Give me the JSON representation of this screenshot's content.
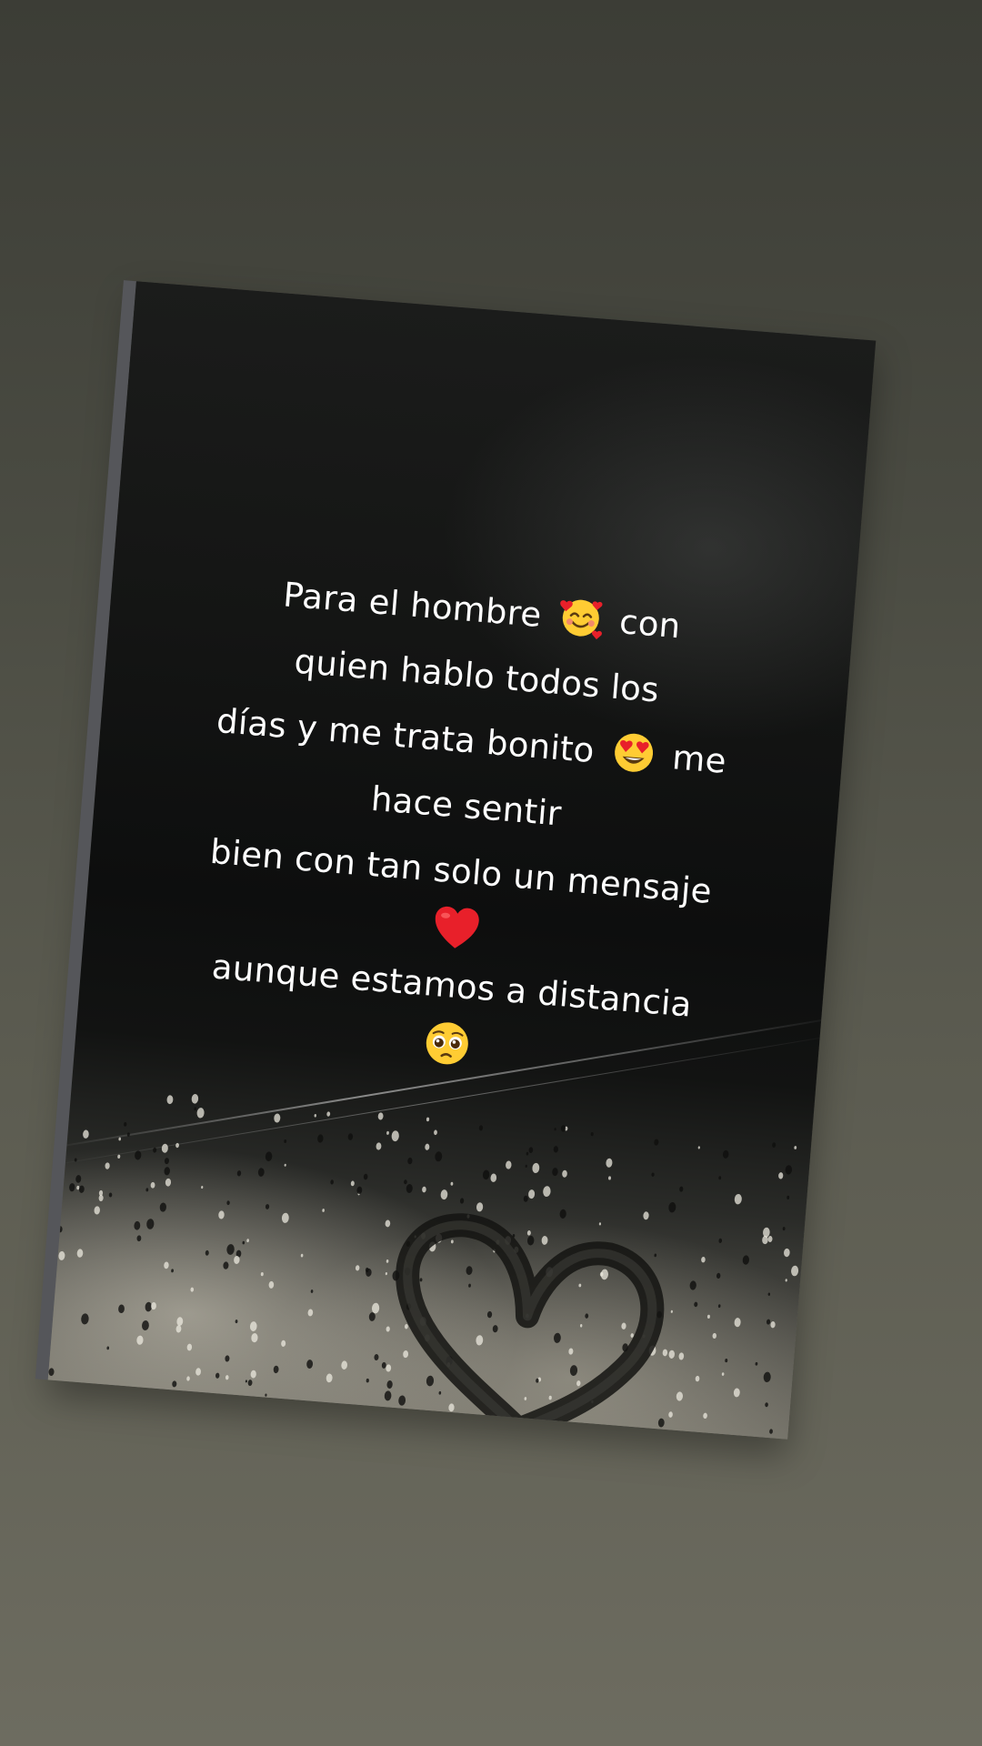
{
  "quote": {
    "line1_a": "Para el hombre",
    "line1_b": "con",
    "line2": "quien hablo todos los",
    "line3_a": "días y me trata bonito",
    "line3_b": "me",
    "line4": "hace sentir",
    "line5": "bien con tan solo un mensaje",
    "line7": "aunque estamos a distancia"
  },
  "emojis": {
    "hug": "smiling-face-with-hearts",
    "love_eyes": "heart-eyes",
    "heart": "red-heart",
    "pleading": "pleading-face"
  },
  "colors": {
    "text": "#ffffff",
    "heart_red": "#e8202a",
    "emoji_yellow": "#ffcc33"
  }
}
